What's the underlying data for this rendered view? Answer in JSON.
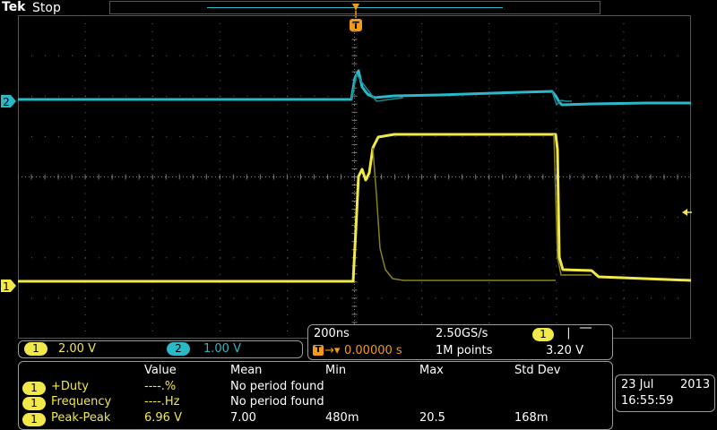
{
  "header": {
    "brand": "Tek",
    "state": "Stop"
  },
  "markers": {
    "trigger_label": "T",
    "ch1_label": "1",
    "ch2_label": "2"
  },
  "scale_panel": {
    "ch1_badge": "1",
    "ch1_scale": "2.00 V",
    "ch2_badge": "2",
    "ch2_scale": "1.00 V"
  },
  "timebase_panel": {
    "time_per_div": "200ns",
    "sample_rate": "2.50GS/s",
    "trigger_badge": "1",
    "trigger_slope": "⎸⎺",
    "trigger_delay_icon": "T",
    "trigger_delay": "0.00000 s",
    "record_length": "1M points",
    "trigger_level": "3.20 V"
  },
  "measurements": {
    "headers": [
      "Value",
      "Mean",
      "Min",
      "Max",
      "Std Dev"
    ],
    "rows": [
      {
        "badge": "1",
        "name": "+Duty",
        "value": "----.%",
        "mean": "No period found",
        "min": "",
        "max": "",
        "std": ""
      },
      {
        "badge": "1",
        "name": "Frequency",
        "value": "----.Hz",
        "mean": "No period found",
        "min": "",
        "max": "",
        "std": ""
      },
      {
        "badge": "1",
        "name": "Peak-Peak",
        "value": "6.96 V",
        "mean": "7.00",
        "min": "480m",
        "max": "20.5",
        "std": "168m"
      }
    ]
  },
  "datetime": {
    "date_day": "23 Jul",
    "date_year": "2013",
    "time": "16:55:59"
  },
  "colors": {
    "ch1": "#f1e84a",
    "ch2": "#29b9c8",
    "trigger": "#f39a1b",
    "grid": "#555555"
  }
}
